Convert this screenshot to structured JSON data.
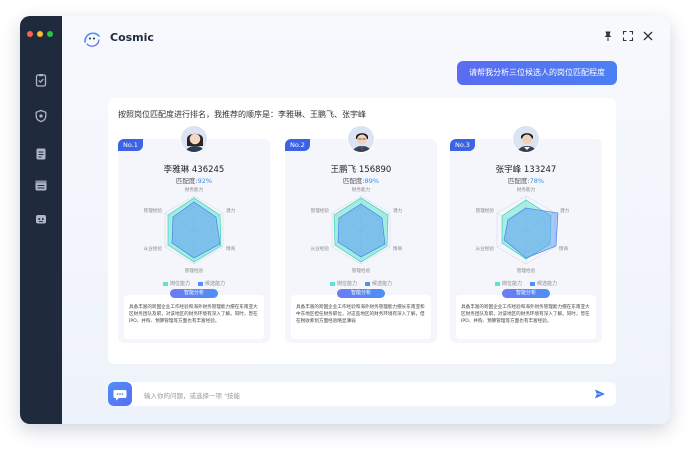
{
  "app": {
    "title": "Cosmic",
    "logo_icon": "cosmic-logo-icon"
  },
  "window_controls": [
    "pin-icon",
    "fullscreen-icon",
    "close-icon"
  ],
  "sidebar": {
    "traffic_lights": [
      "#ff5f57",
      "#febc2e",
      "#28c840"
    ],
    "icons": [
      "clipboard-icon",
      "shield-icon",
      "document-icon",
      "calendar-icon",
      "robot-icon"
    ]
  },
  "user_message": "请帮我分析三位候选人的岗位匹配程度",
  "answer": {
    "summary": "按照岗位匹配度进行排名，我推荐的顺序是：李雅琳、王鹏飞、张宇峰",
    "radar_axes": [
      "财务能力",
      "潜力",
      "情商",
      "管理经验",
      "从业经验",
      "管理经验"
    ],
    "legend": [
      "岗位能力",
      "候选能力"
    ],
    "analysis_label": "智能分析",
    "candidates": [
      {
        "rank": "No.1",
        "name": "李雅琳 436245",
        "match_label": "匹配度:",
        "match": "92%",
        "analysis": "具备丰富的跨国企业工作经验和海外财务管理能力擅在东南亚大区财务团队及职，对该地区的财务环境有深入了解。同时，曾在IPO、并购、预算管理等方面也有丰富经验。"
      },
      {
        "rank": "No.2",
        "name": "王鹏飞 156890",
        "match_label": "匹配度:",
        "match": "89%",
        "analysis": "具备丰富的跨国企业工作经验和海外财务管理能力擅长东南亚和中东地区担任财务职位，对这些地区的财务环境有深入了解，但在税收筹划方面经验略显薄弱"
      },
      {
        "rank": "No.3",
        "name": "张宇峰 133247",
        "match_label": "匹配度:",
        "match": "78%",
        "analysis": "具备丰富的跨国企业工作经验和海外财务管理能力擅在东南亚大区财务团队及职，对该地区的财务环境有深入了解。同时，曾在IPO、并购、预算管理等方面也有丰富经验。"
      }
    ]
  },
  "input": {
    "placeholder": "输入你的问题，或选择一项 \"技能"
  },
  "colors": {
    "accent": "#3b63e6",
    "job": "#5ee3cf",
    "candidate": "#4f8ff6",
    "sidebar": "#1f2a3c"
  }
}
